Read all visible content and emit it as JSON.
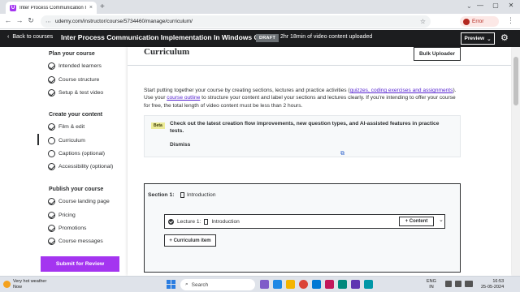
{
  "browser": {
    "tab_title": "Inter Process Communication I",
    "tab_favicon_letter": "U",
    "new_tab": "+",
    "tab_close": "×",
    "url_site_icon": "⋯",
    "url": "udemy.com/instructor/course/5734460/manage/curriculum/",
    "profile_label": "Error",
    "window_min": "—",
    "window_max": "▢",
    "window_close": "✕"
  },
  "header": {
    "back_label": "Back to courses",
    "course_title": "Inter Process Communication Implementation In Windows C++",
    "status_badge": "DRAFT",
    "uploaded_text": "2hr 18min of video content uploaded",
    "preview_label": "Preview"
  },
  "sidebar": {
    "plan_heading": "Plan your course",
    "plan_items": [
      "Intended learners",
      "Course structure",
      "Setup & test video"
    ],
    "create_heading": "Create your content",
    "create_items": [
      "Film & edit",
      "Curriculum",
      "Captions (optional)",
      "Accessibility (optional)"
    ],
    "publish_heading": "Publish your course",
    "publish_items": [
      "Course landing page",
      "Pricing",
      "Promotions",
      "Course messages"
    ],
    "submit_label": "Submit for Review"
  },
  "main": {
    "heading": "Curriculum",
    "bulk_uploader_label": "Bulk Uploader",
    "intro_part1": "Start putting together your course by creating sections, lectures and practice activities (",
    "intro_link1": "quizzes, coding exercises and assignments",
    "intro_part2": "). Use your ",
    "intro_link2": "course outline",
    "intro_part3": " to structure your content and label your sections and lectures clearly. If you're intending to offer your course for free, the total length of video content must be less than 2 hours.",
    "beta_badge": "Beta",
    "notice_text": "Check out the latest creation flow improvements, new question types, and AI-assisted features in practice tests.",
    "dismiss_label": "Dismiss",
    "section_prefix": "Section 1:",
    "section_title": "Introduction",
    "lecture_prefix": "Lecture 1:",
    "lecture_title": "Introduction",
    "add_content_label": "+ Content",
    "curriculum_item_label": "+ Curriculum item"
  },
  "taskbar": {
    "weather_line1": "Very hot weather",
    "weather_line2": "Now",
    "search_placeholder": "Search",
    "lang_line1": "ENG",
    "lang_line2": "IN",
    "time": "16:53",
    "date": "25-05-2024"
  },
  "colors": {
    "brand_purple": "#a435f0",
    "link_purple": "#5624d0",
    "header_dark": "#1c1d1f"
  }
}
